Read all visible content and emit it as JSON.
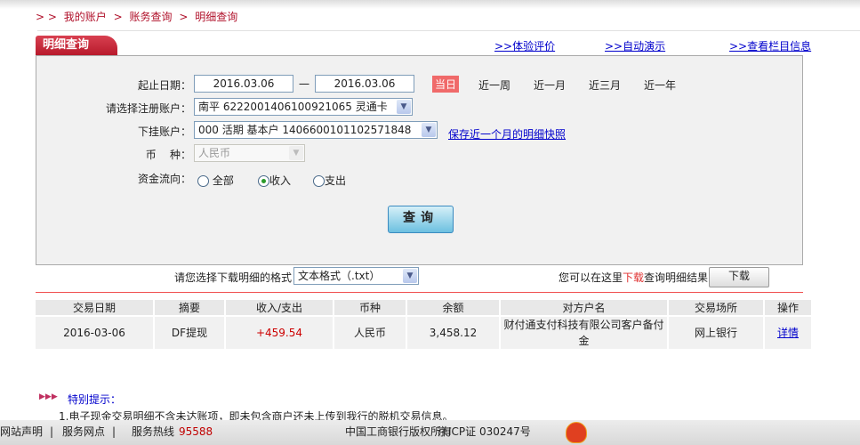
{
  "breadcrumb": {
    "prefix": "> >",
    "items": [
      "我的账户",
      "账务查询",
      "明细查询"
    ],
    "sep": ">"
  },
  "tab_title": "明细查询",
  "top_links": [
    ">>体验评价",
    ">>自动演示",
    ">>查看栏目信息"
  ],
  "form": {
    "date_label": "起止日期：",
    "start_date": "2016.03.06",
    "dash": "一",
    "end_date": "2016.03.06",
    "quick_ranges": [
      "当日",
      "近一周",
      "近一月",
      "近三月",
      "近一年"
    ],
    "account_label": "请选择注册账户：",
    "account_value": "南平  6222001406100921065 灵通卡",
    "sub_account_label": "下挂账户：",
    "sub_account_value": "000 活期 基本户 1406600101102571848",
    "snapshot_link": "保存近一个月的明细快照",
    "currency_label": "币    种：",
    "currency_value": "人民币",
    "flow_label": "资金流向：",
    "flow_options": [
      "全部",
      "收入",
      "支出"
    ],
    "flow_selected": "收入",
    "query_button": "查询"
  },
  "download": {
    "format_label": "请您选择下载明细的格式",
    "format_value": "文本格式（.txt）",
    "hint_pre": "您可以在这里",
    "hint_red": "下载",
    "hint_post": "查询明细结果",
    "button": "下载"
  },
  "table": {
    "headers": [
      "交易日期",
      "摘要",
      "收入/支出",
      "币种",
      "余额",
      "对方户名",
      "交易场所",
      "操作"
    ],
    "rows": [
      [
        "2016-03-06",
        "DF提现",
        "+459.54",
        "人民币",
        "3,458.12",
        "财付通支付科技有限公司客户备付金",
        "网上银行",
        "详情"
      ]
    ]
  },
  "notice": {
    "title": "特别提示：",
    "items": [
      "1.电子现金交易明细不含未达账项，即未包含商户还未上传到我行的脱机交易信息。"
    ]
  },
  "footer": {
    "statement": "网站声明",
    "outlets": "服务网点",
    "hotline_label": "服务热线",
    "hotline": "95588",
    "copyright": "中国工商银行版权所有",
    "icp": "京ICP证 030247号"
  },
  "colors": {
    "brand_red": "#b81a2c",
    "link_blue": "#0000cc",
    "amount_red": "#cc0000"
  }
}
